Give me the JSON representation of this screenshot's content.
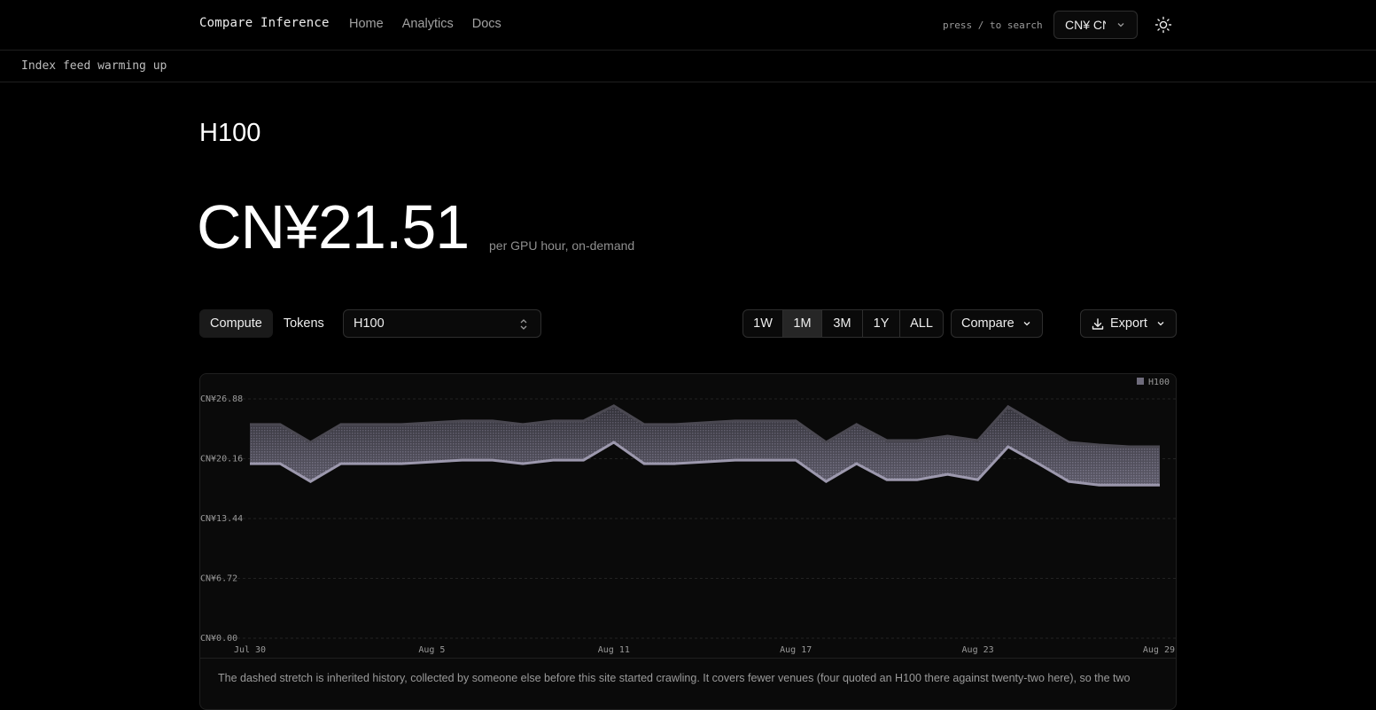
{
  "nav": {
    "brand": "Compare Inference",
    "links": [
      "Home",
      "Analytics",
      "Docs"
    ],
    "search_hint": "press / to search",
    "currency": "CN¥ CNY"
  },
  "banner": {
    "text": "Index feed warming up"
  },
  "page": {
    "title": "H100",
    "price": "CN¥21.51",
    "price_sub": "per GPU hour, on-demand"
  },
  "controls": {
    "kind_tabs": [
      {
        "label": "Compute",
        "active": true
      },
      {
        "label": "Tokens",
        "active": false
      }
    ],
    "model_select": "H100",
    "ranges": [
      {
        "label": "1W",
        "active": false
      },
      {
        "label": "1M",
        "active": true
      },
      {
        "label": "3M",
        "active": false
      },
      {
        "label": "1Y",
        "active": false
      },
      {
        "label": "ALL",
        "active": false
      }
    ],
    "compare_label": "Compare",
    "export_label": "Export"
  },
  "chart_data": {
    "type": "area",
    "legend": [
      "H100"
    ],
    "legend_position": "top-right",
    "y_ticks": [
      "CN¥0.00",
      "CN¥6.72",
      "CN¥13.44",
      "CN¥20.16",
      "CN¥26.88"
    ],
    "ylim": [
      0,
      26.88
    ],
    "x_ticks": [
      "Jul 30",
      "Aug 5",
      "Aug 11",
      "Aug 17",
      "Aug 23",
      "Aug 29"
    ],
    "grid": true,
    "series": [
      {
        "name": "H100",
        "x": [
          0,
          1,
          2,
          3,
          4,
          5,
          6,
          7,
          8,
          9,
          10,
          11,
          12,
          13,
          14,
          15,
          16,
          17,
          18,
          19,
          20,
          21,
          22,
          23,
          24,
          25,
          26,
          27,
          28,
          29,
          30
        ],
        "high": [
          24.0,
          24.0,
          22.0,
          24.0,
          24.0,
          24.0,
          24.2,
          24.4,
          24.4,
          24.0,
          24.4,
          24.4,
          26.1,
          24.0,
          24.0,
          24.2,
          24.4,
          24.4,
          24.4,
          22.0,
          24.0,
          22.2,
          22.2,
          22.7,
          22.2,
          26.0,
          24.0,
          22.0,
          21.7,
          21.5,
          21.5
        ],
        "low": [
          19.6,
          19.6,
          17.6,
          19.6,
          19.6,
          19.6,
          19.8,
          20.0,
          20.0,
          19.6,
          20.0,
          20.0,
          22.0,
          19.6,
          19.6,
          19.8,
          20.0,
          20.0,
          20.0,
          17.6,
          19.6,
          17.8,
          17.8,
          18.4,
          17.8,
          21.5,
          19.6,
          17.6,
          17.2,
          17.2,
          17.2
        ]
      }
    ]
  },
  "chart_note": "The dashed stretch is inherited history, collected by someone else before this site started crawling. It covers fewer venues (four quoted an H100 there against twenty-two here), so the two"
}
